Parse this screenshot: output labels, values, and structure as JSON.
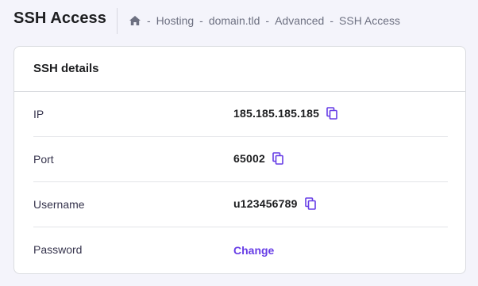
{
  "header": {
    "title": "SSH Access",
    "breadcrumb": {
      "home_icon": "home-icon",
      "separator": "-",
      "items": [
        "Hosting",
        "domain.tld",
        "Advanced",
        "SSH Access"
      ]
    }
  },
  "card": {
    "title": "SSH details",
    "rows": [
      {
        "label": "IP",
        "value": "185.185.185.185",
        "icon": "copy-icon"
      },
      {
        "label": "Port",
        "value": "65002",
        "icon": "copy-icon"
      },
      {
        "label": "Username",
        "value": "u123456789",
        "icon": "copy-icon"
      },
      {
        "label": "Password",
        "action": "Change"
      }
    ]
  },
  "colors": {
    "accent": "#673de6",
    "background": "#f4f4fb",
    "text_dark": "#1d1e20",
    "text_muted": "#6d7081",
    "border": "#dadce0"
  }
}
